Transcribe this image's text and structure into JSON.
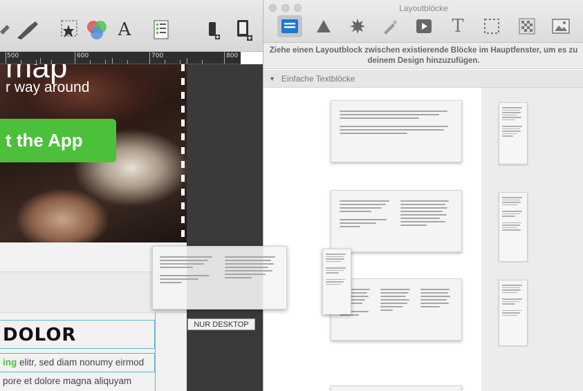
{
  "editor": {
    "toolbar_icons": [
      "brush-icon",
      "paint-bucket-icon",
      "sparkle-selection-icon",
      "color-circles-icon",
      "text-icon",
      "checklist-icon",
      "add-phone-icon",
      "add-tablet-icon"
    ],
    "text_tool_glyph": "A",
    "ruler_labels": [
      "500",
      "600",
      "700",
      "800"
    ],
    "hero": {
      "heading": "map",
      "subtitle": "r way around",
      "button_label": "t the App"
    },
    "section_heading": "DOLOR",
    "body_highlight": "ing",
    "body_line_1": " elitr, sed diam nonumy eirmod",
    "body_line_2": "pore et dolore magna aliquyam",
    "device_badge": "NUR DESKTOP"
  },
  "panel": {
    "title": "Layoutblöcke",
    "tabs": [
      "text-block-tab",
      "shape-tab",
      "badge-tab",
      "pen-tab",
      "video-tab",
      "text-tab",
      "selection-tab",
      "pattern-tab",
      "image-tab"
    ],
    "text_tab_glyph": "T",
    "hint": "Ziehe einen Layoutblock zwischen existierende Blöcke im Hauptfenster, um es zu deinem Design hinzuzufügen.",
    "category": "Einfache Textblöcke"
  },
  "colors": {
    "accent_green": "#4cc03b",
    "guide_blue": "#5ab7d6",
    "selected_tab_blue": "#1a78d6"
  }
}
